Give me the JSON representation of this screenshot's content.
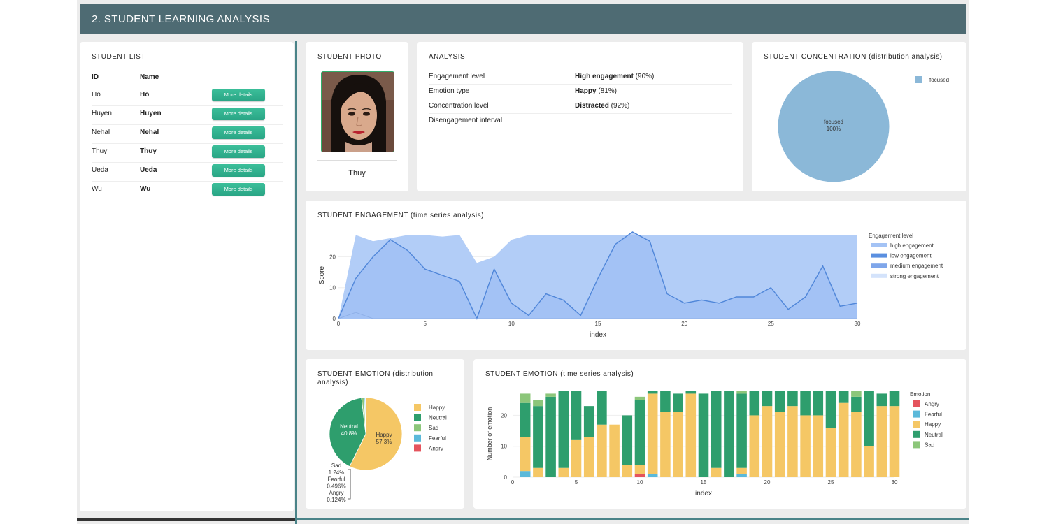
{
  "header": {
    "title": "2. STUDENT LEARNING ANALYSIS"
  },
  "student_list": {
    "title": "STUDENT LIST",
    "col_id": "ID",
    "col_name": "Name",
    "rows": [
      {
        "id": "Ho",
        "name": "Ho",
        "button": "More details"
      },
      {
        "id": "Huyen",
        "name": "Huyen",
        "button": "More details"
      },
      {
        "id": "Nehal",
        "name": "Nehal",
        "button": "More details"
      },
      {
        "id": "Thuy",
        "name": "Thuy",
        "button": "More details"
      },
      {
        "id": "Ueda",
        "name": "Ueda",
        "button": "More details"
      },
      {
        "id": "Wu",
        "name": "Wu",
        "button": "More details"
      }
    ]
  },
  "photo": {
    "title": "STUDENT PHOTO",
    "name": "Thuy"
  },
  "analysis": {
    "title": "ANALYSIS",
    "rows": [
      {
        "key": "Engagement level",
        "value_bold": "High engagement",
        "value_rest": " (90%)"
      },
      {
        "key": "Emotion type",
        "value_bold": "Happy",
        "value_rest": " (81%)"
      },
      {
        "key": "Concentration level",
        "value_bold": "Distracted",
        "value_rest": " (92%)"
      },
      {
        "key": "Disengagement interval",
        "value_bold": "",
        "value_rest": ""
      }
    ]
  },
  "concentration": {
    "title": "STUDENT CONCENTRATION (distribution analysis)",
    "color": "#8bb8d8"
  },
  "engagement": {
    "title": "STUDENT ENGAGEMENT (time series analysis)"
  },
  "emotion_pie": {
    "title_line1": "STUDENT EMOTION (distribution",
    "title_line2": "analysis)"
  },
  "emotion_ts": {
    "title": "STUDENT EMOTION (time series analysis)"
  },
  "colors": {
    "happy": "#f5c765",
    "neutral": "#2e9e6d",
    "sad": "#8cc67a",
    "fearful": "#5bb9da",
    "angry": "#e5545d",
    "engagement_fill": "#b2cdf7",
    "engagement_line": "#4f86d9",
    "header": "#4e6b73"
  },
  "chart_data": [
    {
      "type": "pie",
      "labels": [
        "focused"
      ],
      "values": [
        100
      ],
      "slice_labels": [
        "focused 100%"
      ],
      "legend": [
        "focused"
      ]
    },
    {
      "type": "area",
      "xlabel": "index",
      "ylabel": "Score",
      "xlim": [
        0,
        30
      ],
      "ylim": [
        0,
        28
      ],
      "xticks": [
        0,
        5,
        10,
        15,
        20,
        25,
        30
      ],
      "yticks": [
        0,
        10,
        20
      ],
      "legend_title": "Engagement level",
      "x": [
        0,
        1,
        2,
        3,
        4,
        5,
        6,
        7,
        8,
        9,
        10,
        11,
        12,
        13,
        14,
        15,
        16,
        17,
        18,
        19,
        20,
        21,
        22,
        23,
        24,
        25,
        26,
        27,
        28,
        29,
        30
      ],
      "series": [
        {
          "name": "high engagement",
          "values": [
            0,
            27,
            25,
            26,
            27,
            27,
            26.5,
            27,
            18,
            20,
            25.5,
            27,
            27,
            27,
            27,
            27,
            27,
            27,
            27,
            27,
            27,
            27,
            27,
            27,
            27,
            27,
            27,
            27,
            27,
            27,
            27
          ]
        },
        {
          "name": "low engagement",
          "values": [
            0,
            13,
            20,
            25.5,
            22,
            16,
            14,
            12,
            0,
            16,
            5,
            1,
            8,
            6,
            1,
            13,
            24,
            28,
            25,
            8,
            5,
            6,
            5,
            7,
            7,
            10,
            3,
            7,
            17,
            4,
            5
          ]
        },
        {
          "name": "medium engagement",
          "values": [
            0,
            2,
            0,
            0,
            0,
            0,
            0,
            0,
            0,
            0,
            0,
            0,
            0,
            0,
            0,
            0,
            0,
            0,
            0,
            0,
            0,
            0,
            0,
            0,
            0,
            0,
            0,
            0,
            0,
            0,
            0
          ]
        },
        {
          "name": "strong engagement",
          "values": []
        }
      ]
    },
    {
      "type": "pie",
      "labels": [
        "Happy",
        "Neutral",
        "Sad",
        "Fearful",
        "Angry"
      ],
      "values": [
        57.3,
        40.8,
        1.24,
        0.496,
        0.124
      ],
      "slice_labels": [
        "Happy 57.3%",
        "Neutral 40.8%",
        "Sad 1.24%",
        "Fearful 0.496%",
        "Angry 0.124%"
      ],
      "legend": [
        "Happy",
        "Neutral",
        "Sad",
        "Fearful",
        "Angry"
      ]
    },
    {
      "type": "bar",
      "stacked": true,
      "xlabel": "index",
      "ylabel": "Number of emotion",
      "xlim": [
        0,
        30
      ],
      "ylim": [
        0,
        28
      ],
      "xticks": [
        0,
        5,
        10,
        15,
        20,
        25,
        30
      ],
      "yticks": [
        0,
        10,
        20
      ],
      "legend_title": "Emotion",
      "legend": [
        "Angry",
        "Fearful",
        "Happy",
        "Neutral",
        "Sad"
      ],
      "x": [
        1,
        2,
        3,
        4,
        5,
        6,
        7,
        8,
        9,
        10,
        11,
        12,
        13,
        14,
        15,
        16,
        17,
        18,
        19,
        20,
        21,
        22,
        23,
        24,
        25,
        26,
        27,
        28,
        29,
        30
      ],
      "series": [
        {
          "name": "Angry",
          "values": [
            0,
            0,
            0,
            0,
            0,
            0,
            0,
            0,
            0,
            1,
            0,
            0,
            0,
            0,
            0,
            0,
            0,
            0,
            0,
            0,
            0,
            0,
            0,
            0,
            0,
            0,
            0,
            0,
            0,
            0
          ]
        },
        {
          "name": "Fearful",
          "values": [
            2,
            0,
            0,
            0,
            0,
            0,
            0,
            0,
            0,
            0,
            1,
            0,
            0,
            0,
            0,
            0,
            0,
            1,
            0,
            0,
            0,
            0,
            0,
            0,
            0,
            0,
            0,
            0,
            0,
            0
          ]
        },
        {
          "name": "Happy",
          "values": [
            11,
            3,
            0,
            3,
            12,
            13,
            17,
            17,
            4,
            3,
            26,
            21,
            21,
            27,
            0,
            3,
            0,
            2,
            20,
            23,
            21,
            23,
            20,
            20,
            16,
            24,
            21,
            10,
            23,
            23
          ]
        },
        {
          "name": "Neutral",
          "values": [
            11,
            20,
            26,
            25,
            16,
            10,
            11,
            0,
            16,
            21,
            1,
            7,
            6,
            1,
            27,
            25,
            28,
            24,
            8,
            5,
            7,
            5,
            8,
            8,
            12,
            4,
            5,
            18,
            4,
            5
          ]
        },
        {
          "name": "Sad",
          "values": [
            3,
            2,
            1,
            0,
            0,
            0,
            0,
            0,
            0,
            1,
            0,
            0,
            0,
            0,
            0,
            0,
            0,
            1,
            0,
            0,
            0,
            0,
            0,
            0,
            0,
            0,
            2,
            0,
            0,
            0
          ]
        }
      ]
    }
  ]
}
